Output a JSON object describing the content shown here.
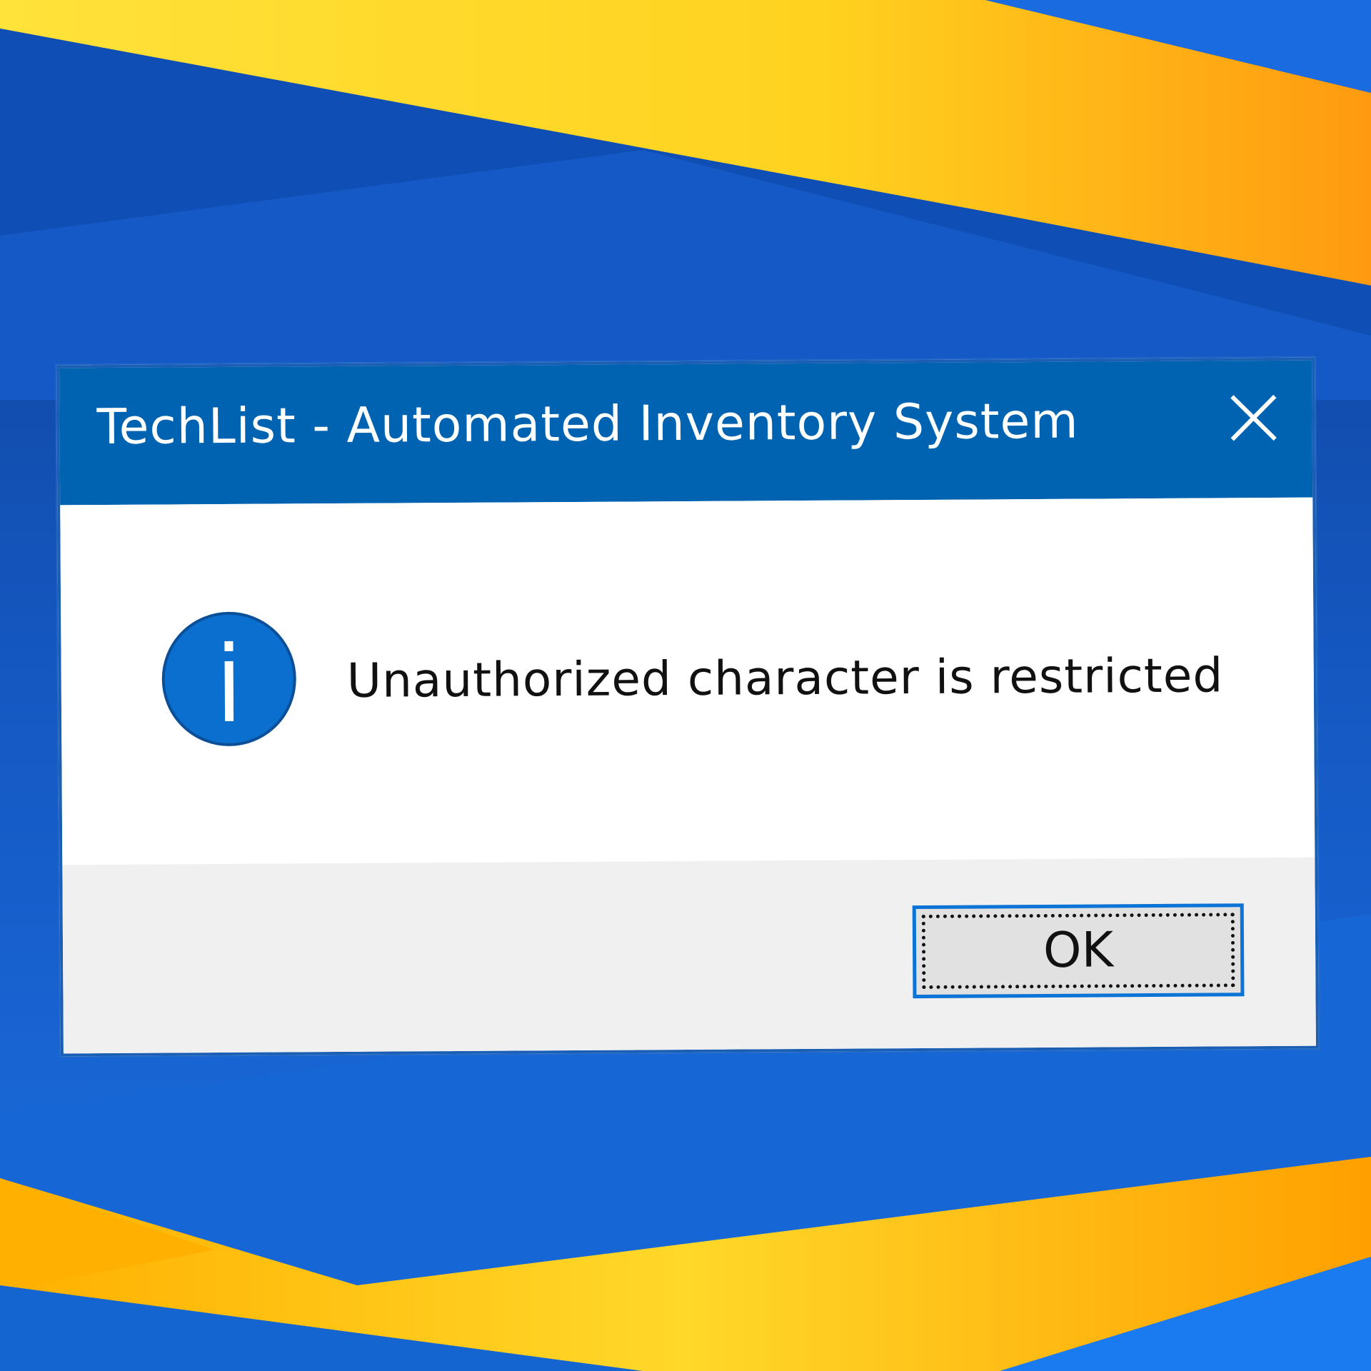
{
  "dialog": {
    "title": "TechList - Automated Inventory System",
    "message": "Unauthorized character is restricted",
    "icon": "info-icon",
    "close_icon": "close-icon",
    "ok_label": "OK"
  },
  "colors": {
    "titlebar": "#0063b1",
    "info_icon": "#0b6fd0",
    "button_focus_border": "#0b74d6",
    "wallpaper_blue": "#1565d0",
    "wallpaper_yellow": "#ffd21f"
  }
}
